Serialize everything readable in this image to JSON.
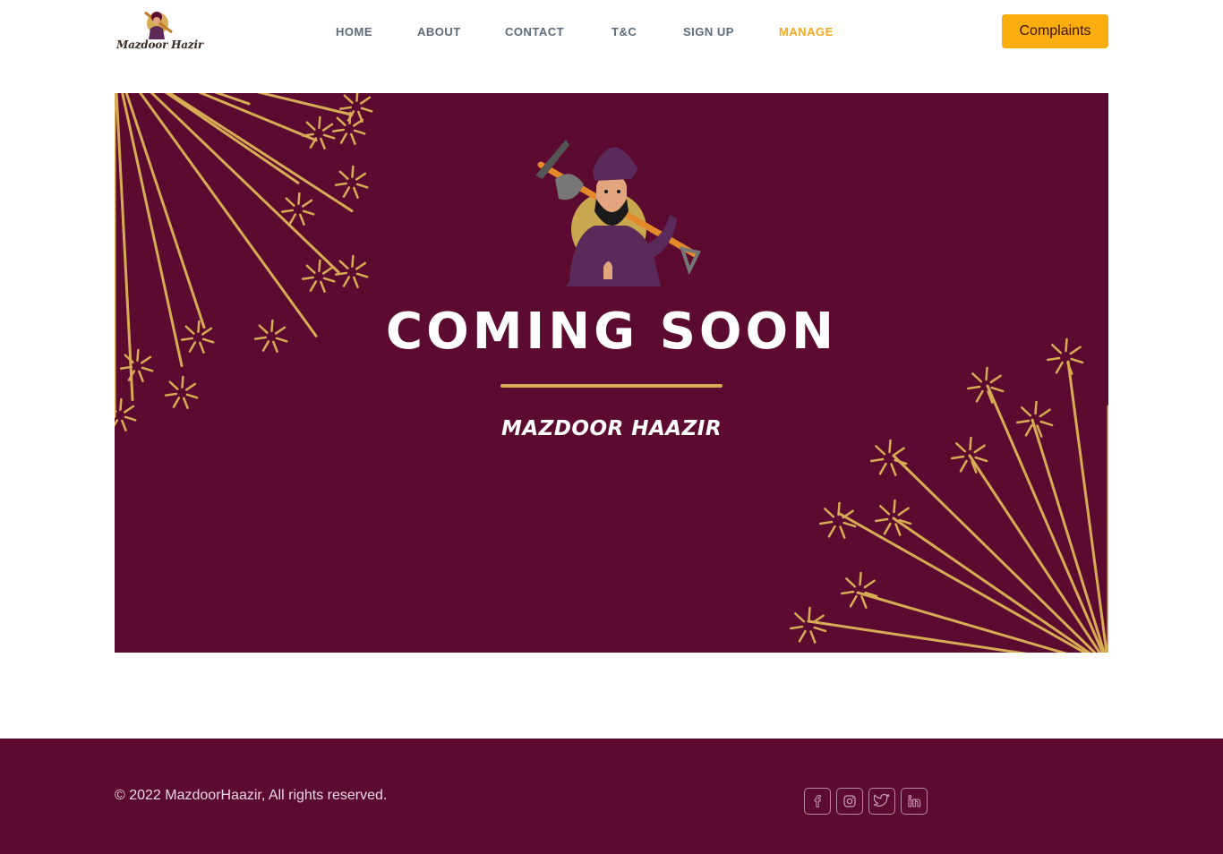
{
  "brand": {
    "logo_text": "Mazdoor Hazir"
  },
  "nav": {
    "items": [
      {
        "label": "HOME"
      },
      {
        "label": "ABOUT"
      },
      {
        "label": "CONTACT"
      },
      {
        "label": "T&C"
      },
      {
        "label": "SIGN UP"
      },
      {
        "label": "MANAGE",
        "active": true
      }
    ],
    "cta_label": "Complaints"
  },
  "banner": {
    "headline": "COMING SOON",
    "subtitle": "MAZDOOR HAAZIR"
  },
  "footer": {
    "copyright": "© 2022 MazdoorHaazir, All rights reserved.",
    "social": [
      "facebook-icon",
      "instagram-icon",
      "twitter-icon",
      "linkedin-icon"
    ]
  },
  "colors": {
    "primary_maroon": "#5d0a30",
    "accent_orange": "#f9ad0f",
    "gold": "#d6ac55",
    "nav_text": "#5c6b7a",
    "nav_active": "#f4a81d"
  }
}
